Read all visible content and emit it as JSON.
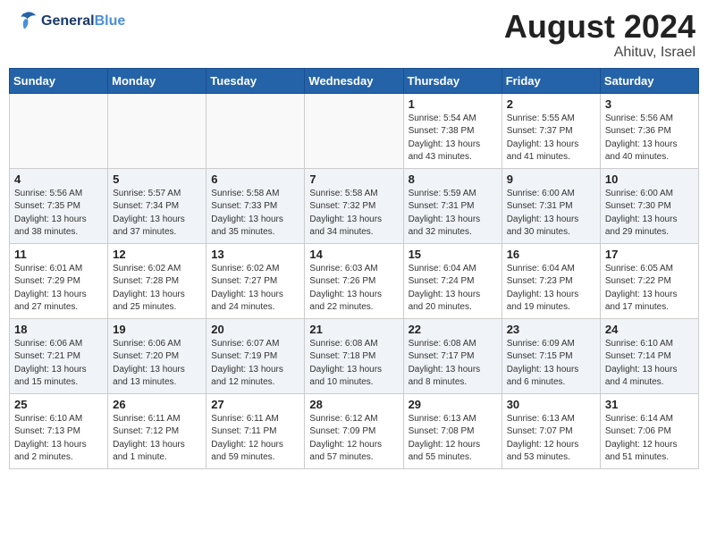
{
  "logo": {
    "line1": "General",
    "line2": "Blue"
  },
  "title": "August 2024",
  "location": "Ahituv, Israel",
  "days_header": [
    "Sunday",
    "Monday",
    "Tuesday",
    "Wednesday",
    "Thursday",
    "Friday",
    "Saturday"
  ],
  "weeks": [
    [
      {
        "day": "",
        "info": ""
      },
      {
        "day": "",
        "info": ""
      },
      {
        "day": "",
        "info": ""
      },
      {
        "day": "",
        "info": ""
      },
      {
        "day": "1",
        "info": "Sunrise: 5:54 AM\nSunset: 7:38 PM\nDaylight: 13 hours\nand 43 minutes."
      },
      {
        "day": "2",
        "info": "Sunrise: 5:55 AM\nSunset: 7:37 PM\nDaylight: 13 hours\nand 41 minutes."
      },
      {
        "day": "3",
        "info": "Sunrise: 5:56 AM\nSunset: 7:36 PM\nDaylight: 13 hours\nand 40 minutes."
      }
    ],
    [
      {
        "day": "4",
        "info": "Sunrise: 5:56 AM\nSunset: 7:35 PM\nDaylight: 13 hours\nand 38 minutes."
      },
      {
        "day": "5",
        "info": "Sunrise: 5:57 AM\nSunset: 7:34 PM\nDaylight: 13 hours\nand 37 minutes."
      },
      {
        "day": "6",
        "info": "Sunrise: 5:58 AM\nSunset: 7:33 PM\nDaylight: 13 hours\nand 35 minutes."
      },
      {
        "day": "7",
        "info": "Sunrise: 5:58 AM\nSunset: 7:32 PM\nDaylight: 13 hours\nand 34 minutes."
      },
      {
        "day": "8",
        "info": "Sunrise: 5:59 AM\nSunset: 7:31 PM\nDaylight: 13 hours\nand 32 minutes."
      },
      {
        "day": "9",
        "info": "Sunrise: 6:00 AM\nSunset: 7:31 PM\nDaylight: 13 hours\nand 30 minutes."
      },
      {
        "day": "10",
        "info": "Sunrise: 6:00 AM\nSunset: 7:30 PM\nDaylight: 13 hours\nand 29 minutes."
      }
    ],
    [
      {
        "day": "11",
        "info": "Sunrise: 6:01 AM\nSunset: 7:29 PM\nDaylight: 13 hours\nand 27 minutes."
      },
      {
        "day": "12",
        "info": "Sunrise: 6:02 AM\nSunset: 7:28 PM\nDaylight: 13 hours\nand 25 minutes."
      },
      {
        "day": "13",
        "info": "Sunrise: 6:02 AM\nSunset: 7:27 PM\nDaylight: 13 hours\nand 24 minutes."
      },
      {
        "day": "14",
        "info": "Sunrise: 6:03 AM\nSunset: 7:26 PM\nDaylight: 13 hours\nand 22 minutes."
      },
      {
        "day": "15",
        "info": "Sunrise: 6:04 AM\nSunset: 7:24 PM\nDaylight: 13 hours\nand 20 minutes."
      },
      {
        "day": "16",
        "info": "Sunrise: 6:04 AM\nSunset: 7:23 PM\nDaylight: 13 hours\nand 19 minutes."
      },
      {
        "day": "17",
        "info": "Sunrise: 6:05 AM\nSunset: 7:22 PM\nDaylight: 13 hours\nand 17 minutes."
      }
    ],
    [
      {
        "day": "18",
        "info": "Sunrise: 6:06 AM\nSunset: 7:21 PM\nDaylight: 13 hours\nand 15 minutes."
      },
      {
        "day": "19",
        "info": "Sunrise: 6:06 AM\nSunset: 7:20 PM\nDaylight: 13 hours\nand 13 minutes."
      },
      {
        "day": "20",
        "info": "Sunrise: 6:07 AM\nSunset: 7:19 PM\nDaylight: 13 hours\nand 12 minutes."
      },
      {
        "day": "21",
        "info": "Sunrise: 6:08 AM\nSunset: 7:18 PM\nDaylight: 13 hours\nand 10 minutes."
      },
      {
        "day": "22",
        "info": "Sunrise: 6:08 AM\nSunset: 7:17 PM\nDaylight: 13 hours\nand 8 minutes."
      },
      {
        "day": "23",
        "info": "Sunrise: 6:09 AM\nSunset: 7:15 PM\nDaylight: 13 hours\nand 6 minutes."
      },
      {
        "day": "24",
        "info": "Sunrise: 6:10 AM\nSunset: 7:14 PM\nDaylight: 13 hours\nand 4 minutes."
      }
    ],
    [
      {
        "day": "25",
        "info": "Sunrise: 6:10 AM\nSunset: 7:13 PM\nDaylight: 13 hours\nand 2 minutes."
      },
      {
        "day": "26",
        "info": "Sunrise: 6:11 AM\nSunset: 7:12 PM\nDaylight: 13 hours\nand 1 minute."
      },
      {
        "day": "27",
        "info": "Sunrise: 6:11 AM\nSunset: 7:11 PM\nDaylight: 12 hours\nand 59 minutes."
      },
      {
        "day": "28",
        "info": "Sunrise: 6:12 AM\nSunset: 7:09 PM\nDaylight: 12 hours\nand 57 minutes."
      },
      {
        "day": "29",
        "info": "Sunrise: 6:13 AM\nSunset: 7:08 PM\nDaylight: 12 hours\nand 55 minutes."
      },
      {
        "day": "30",
        "info": "Sunrise: 6:13 AM\nSunset: 7:07 PM\nDaylight: 12 hours\nand 53 minutes."
      },
      {
        "day": "31",
        "info": "Sunrise: 6:14 AM\nSunset: 7:06 PM\nDaylight: 12 hours\nand 51 minutes."
      }
    ]
  ]
}
